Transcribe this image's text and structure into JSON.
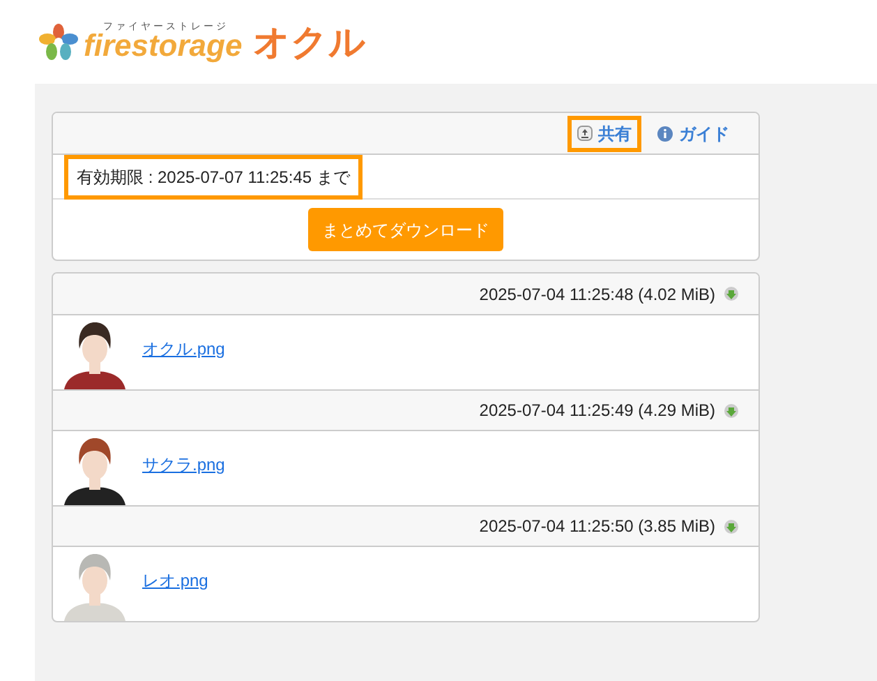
{
  "logo": {
    "ruby": "ファイヤーストレージ",
    "brand": "firestorage",
    "product": "オクル"
  },
  "toolbar": {
    "links": [
      {
        "kind": "share",
        "label": "共有",
        "highlighted": true
      },
      {
        "kind": "guide",
        "label": "ガイド",
        "highlighted": false
      }
    ]
  },
  "expiry": {
    "text": "有効期限 : 2025-07-07 11:25:45 まで",
    "highlighted": true
  },
  "download_all_button": "まとめてダウンロード",
  "files": [
    {
      "timestamp": "2025-07-04 11:25:48 (4.02 MiB)",
      "name": "オクル.png"
    },
    {
      "timestamp": "2025-07-04 11:25:49 (4.29 MiB)",
      "name": "サクラ.png"
    },
    {
      "timestamp": "2025-07-04 11:25:50 (3.85 MiB)",
      "name": "レオ.png"
    }
  ]
}
